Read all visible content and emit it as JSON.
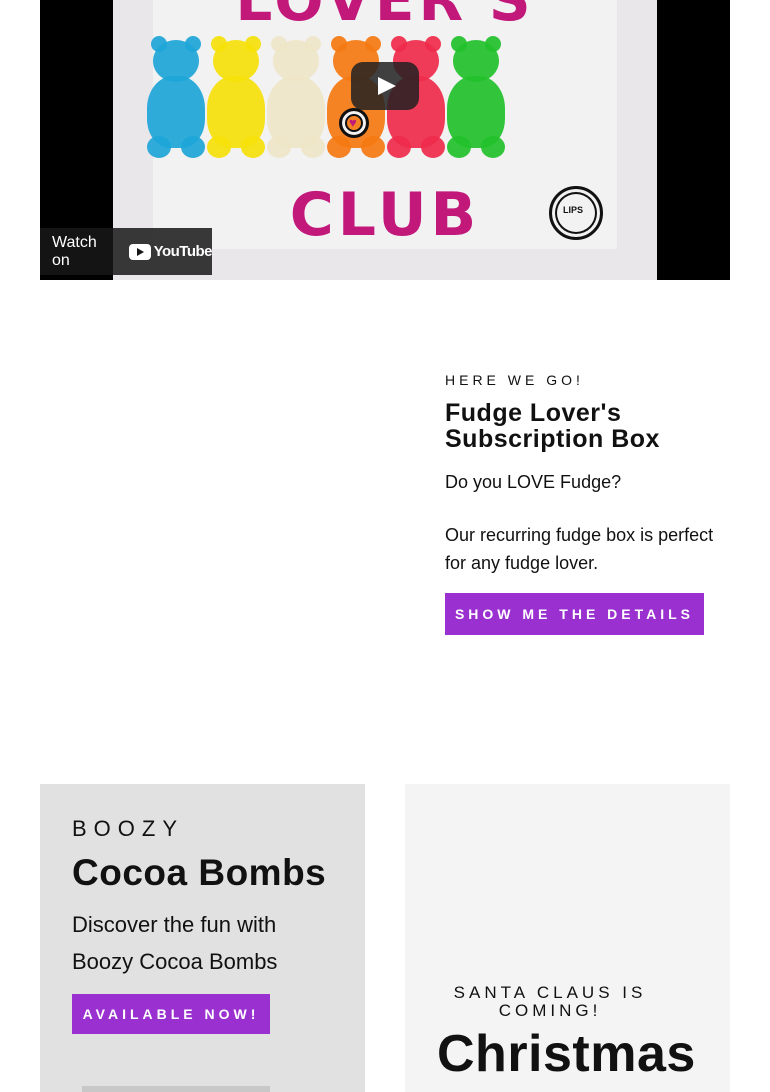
{
  "video": {
    "title_top": "LOVER'S",
    "title_bottom": "CLUB",
    "watch_on_label": "Watch on",
    "youtube_label": "YouTube",
    "bear_colors": [
      "#1ea5d8",
      "#f5e10a",
      "#efe6c8",
      "#f57a12",
      "#ef2b4b",
      "#22c12c"
    ]
  },
  "subscription": {
    "eyebrow": "HERE WE GO!",
    "title": "Fudge Lover's Subscription Box",
    "paragraph1": "Do you LOVE Fudge?",
    "paragraph2": "Our recurring fudge box is perfect for any fudge lover.",
    "button": "SHOW ME THE DETAILS"
  },
  "cards": {
    "left": {
      "eyebrow": "BOOZY",
      "title": "Cocoa Bombs",
      "description": "Discover the fun with Boozy Cocoa Bombs",
      "button": "AVAILABLE NOW!"
    },
    "right": {
      "eyebrow": "SANTA CLAUS IS COMING!",
      "title": "Christmas"
    }
  },
  "colors": {
    "accent": "#9b30d0",
    "video_title": "#c2187a",
    "card_left_bg": "#e1e1e1",
    "card_right_bg": "#f4f4f4"
  },
  "icons": [
    "play-icon",
    "youtube-logo-icon",
    "heart-logo-icon",
    "lips-logo-icon"
  ]
}
